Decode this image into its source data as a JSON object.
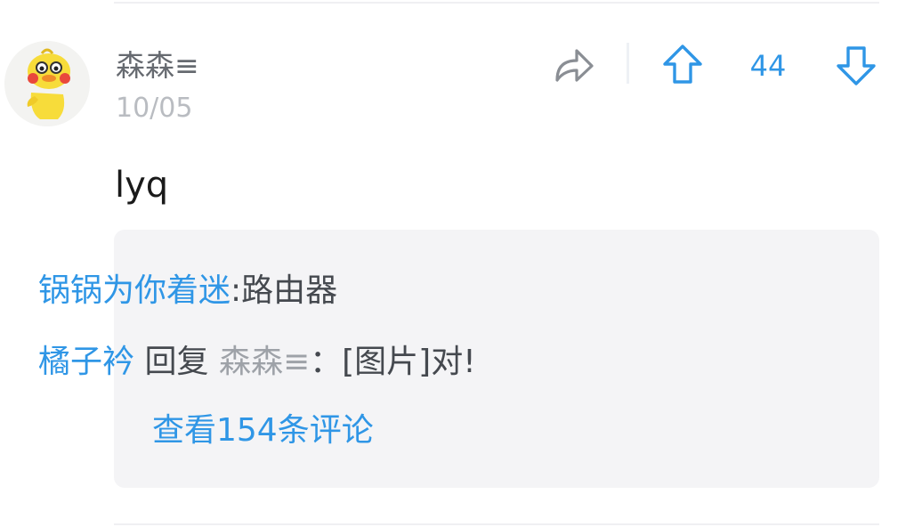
{
  "comment": {
    "username": "森森≡",
    "date": "10/05",
    "content": "lyq",
    "vote_count": "44",
    "icons": {
      "avatar": "yellow-duck-avatar",
      "share": "share-arrow-icon",
      "upvote": "arrow-up-icon",
      "downvote": "arrow-down-icon"
    }
  },
  "replies": [
    {
      "author": "锅锅为你着迷",
      "separator": ":",
      "text": "路由器"
    },
    {
      "author": "橘子衿",
      "reply_word": "回复",
      "target": "森森≡",
      "separator": "：",
      "text": "[图片]对!"
    }
  ],
  "view_more": "查看154条评论",
  "colors": {
    "accent": "#2f96e6",
    "username": "#666a70",
    "date": "#b9bcc1",
    "reply_box": "#f4f4f6",
    "text": "#1a1a1a"
  }
}
